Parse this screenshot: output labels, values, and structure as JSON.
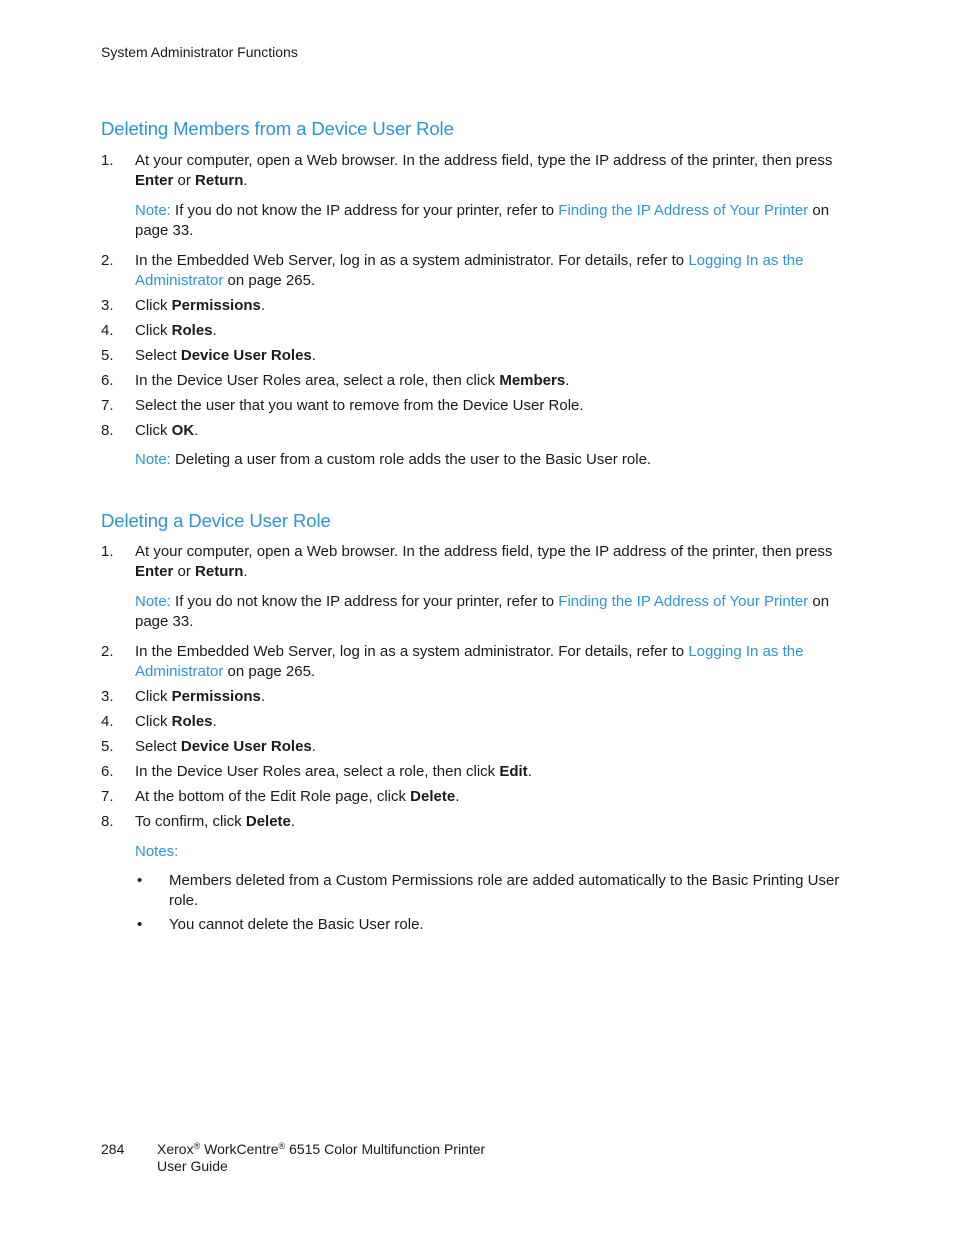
{
  "header": {
    "running_title": "System Administrator Functions"
  },
  "sections": [
    {
      "title": "Deleting Members from a Device User Role",
      "steps": [
        {
          "num": "1.",
          "pre": "At your computer, open a Web browser. In the address field, type the IP address of the printer, then press ",
          "b1": "Enter",
          "mid": " or ",
          "b2": "Return",
          "post": "."
        },
        {
          "num": "2.",
          "pre": "In the Embedded Web Server, log in as a system administrator. For details, refer to ",
          "link": "Logging In as the Administrator",
          "post": " on page 265."
        },
        {
          "num": "3.",
          "pre": "Click ",
          "b1": "Permissions",
          "post": "."
        },
        {
          "num": "4.",
          "pre": "Click ",
          "b1": "Roles",
          "post": "."
        },
        {
          "num": "5.",
          "pre": "Select ",
          "b1": "Device User Roles",
          "post": "."
        },
        {
          "num": "6.",
          "pre": "In the Device User Roles area, select a role, then click ",
          "b1": "Members",
          "post": "."
        },
        {
          "num": "7.",
          "pre": "Select the user that you want to remove from the Device User Role."
        },
        {
          "num": "8.",
          "pre": "Click ",
          "b1": "OK",
          "post": "."
        }
      ],
      "note1": {
        "label": "Note:",
        "pre": " If you do not know the IP address for your printer, refer to ",
        "link": "Finding the IP Address of Your Printer",
        "post": " on page 33."
      },
      "note2": {
        "label": "Note:",
        "text": " Deleting a user from a custom role adds the user to the Basic User role."
      }
    },
    {
      "title": "Deleting a Device User Role",
      "steps": [
        {
          "num": "1.",
          "pre": "At your computer, open a Web browser. In the address field, type the IP address of the printer, then press ",
          "b1": "Enter",
          "mid": " or ",
          "b2": "Return",
          "post": "."
        },
        {
          "num": "2.",
          "pre": "In the Embedded Web Server, log in as a system administrator. For details, refer to ",
          "link": "Logging In as the Administrator",
          "post": " on page 265."
        },
        {
          "num": "3.",
          "pre": "Click ",
          "b1": "Permissions",
          "post": "."
        },
        {
          "num": "4.",
          "pre": "Click ",
          "b1": "Roles",
          "post": "."
        },
        {
          "num": "5.",
          "pre": "Select ",
          "b1": "Device User Roles",
          "post": "."
        },
        {
          "num": "6.",
          "pre": "In the Device User Roles area, select a role, then click ",
          "b1": "Edit",
          "post": "."
        },
        {
          "num": "7.",
          "pre": "At the bottom of the Edit Role page, click ",
          "b1": "Delete",
          "post": "."
        },
        {
          "num": "8.",
          "pre": "To confirm, click ",
          "b1": "Delete",
          "post": "."
        }
      ],
      "note1": {
        "label": "Note:",
        "pre": " If you do not know the IP address for your printer, refer to ",
        "link": "Finding the IP Address of Your Printer",
        "post": " on page 33."
      },
      "notes_label": "Notes:",
      "bullets": [
        "Members deleted from a Custom Permissions role are added automatically to the Basic Printing User role.",
        "You cannot delete the Basic User role."
      ]
    }
  ],
  "footer": {
    "page_number": "284",
    "brand": "Xerox",
    "product": "WorkCentre",
    "model": "6515 Color Multifunction Printer",
    "guide": "User Guide",
    "reg_mark": "®"
  }
}
